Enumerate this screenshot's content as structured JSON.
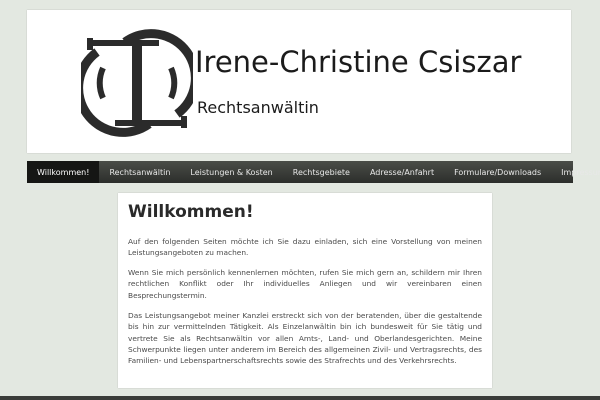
{
  "header": {
    "title": "Irene-Christine Csiszar",
    "subtitle": "Rechtsanwältin"
  },
  "nav": {
    "items": [
      {
        "label": "Willkommen!",
        "active": true
      },
      {
        "label": "Rechtsanwältin"
      },
      {
        "label": "Leistungen & Kosten"
      },
      {
        "label": "Rechtsgebiete"
      },
      {
        "label": "Adresse/Anfahrt"
      },
      {
        "label": "Formulare/Downloads"
      },
      {
        "label": "Impressum"
      }
    ]
  },
  "main": {
    "heading": "Willkommen!",
    "paragraphs": [
      "Auf den folgenden Seiten möchte ich Sie dazu einladen, sich eine Vorstellung von meinen Leistungsangeboten zu machen.",
      "Wenn Sie mich persönlich kennenlernen möchten, rufen Sie mich gern an, schildern mir Ihren rechtlichen Konflikt oder Ihr individuelles Anliegen und wir vereinbaren einen Besprechungstermin.",
      "Das Leistungsangebot meiner Kanzlei erstreckt sich von der beratenden, über die gestaltende bis hin zur vermittelnden Tätigkeit. Als Einzelanwältin bin ich bundesweit für Sie tätig und vertrete Sie als Rechtsanwältin vor allen Amts-, Land- und Oberlandesgerichten. Meine Schwerpunkte liegen unter anderem im Bereich des allgemeinen Zivil- und Vertragsrechts, des Familien- und Lebenspartnerschaftsrechts sowie des Strafrechts und des Verkehrsrechts."
    ]
  },
  "colors": {
    "background": "#e3e8e1",
    "nav_bar": "#3a3c39",
    "nav_active": "#151614",
    "logo": "#2b2b2b"
  },
  "icons": {
    "logo": "ic-monogram-logo"
  }
}
